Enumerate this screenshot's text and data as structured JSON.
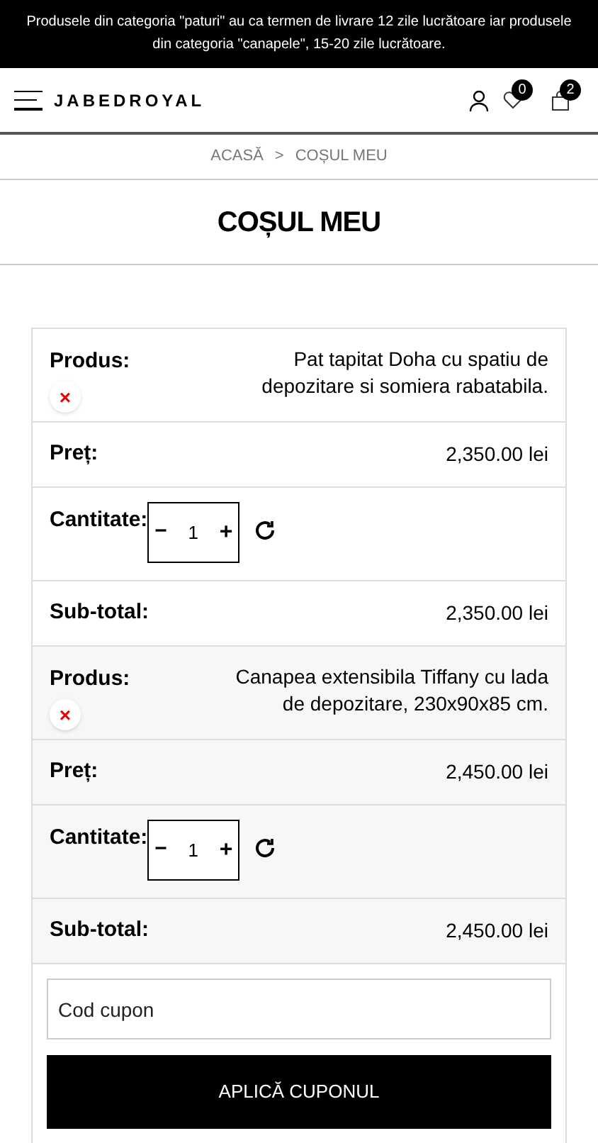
{
  "notice": "Produsele din categoria \"paturi\" au ca termen de livrare 12 zile lucrătoare iar produsele din categoria \"canapele\", 15-20 zile lucrătoare.",
  "header": {
    "logo": "JABEDROYAL",
    "wishlist_count": "0",
    "cart_count": "2"
  },
  "breadcrumb": [
    "ACASĂ",
    "COȘUL MEU"
  ],
  "breadcrumb_separator": ">",
  "title": "COȘUL MEU",
  "items": [
    {
      "product_label": "Produs:",
      "remove": "×",
      "product": "Pat tapitat Doha cu spatiu de depozitare si somiera rabatabila.",
      "price_label": "Preț:",
      "price": "2,350.00 lei",
      "quantity_label": "Cantitate:",
      "minus": "−",
      "quantity": "1",
      "plus": "+",
      "subtotal_label": "Sub-total:",
      "subtotal": "2,350.00 lei"
    },
    {
      "product_label": "Produs:",
      "remove": "×",
      "product": "Canapea extensibila Tiffany cu lada de depozitare, 230x90x85 cm.",
      "price_label": "Preț:",
      "price": "2,450.00 lei",
      "quantity_label": "Cantitate:",
      "minus": "−",
      "quantity": "1",
      "plus": "+",
      "subtotal_label": "Sub-total:",
      "subtotal": "2,450.00 lei"
    }
  ],
  "coupon": {
    "placeholder": "Cod cupon",
    "button": "APLICĂ CUPONUL"
  }
}
